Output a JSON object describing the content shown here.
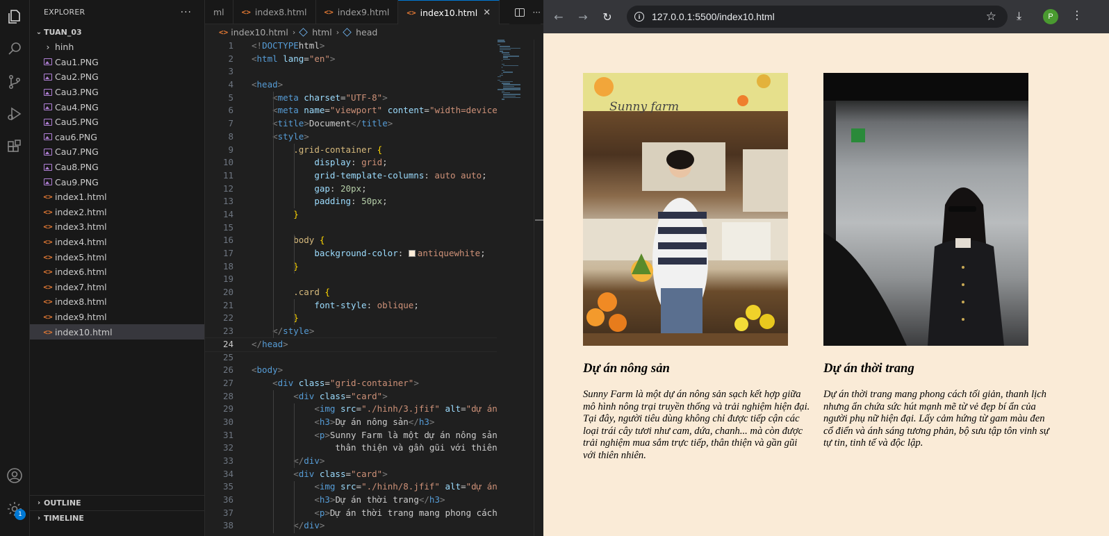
{
  "explorer": {
    "header": "EXPLORER",
    "folder": "TUAN_03",
    "items": [
      {
        "label": "hinh",
        "type": "folder"
      },
      {
        "label": "Cau1.PNG",
        "type": "image"
      },
      {
        "label": "Cau2.PNG",
        "type": "image"
      },
      {
        "label": "Cau3.PNG",
        "type": "image"
      },
      {
        "label": "Cau4.PNG",
        "type": "image"
      },
      {
        "label": "Cau5.PNG",
        "type": "image"
      },
      {
        "label": "cau6.PNG",
        "type": "image"
      },
      {
        "label": "Cau7.PNG",
        "type": "image"
      },
      {
        "label": "Cau8.PNG",
        "type": "image"
      },
      {
        "label": "Cau9.PNG",
        "type": "image"
      },
      {
        "label": "index1.html",
        "type": "html"
      },
      {
        "label": "index2.html",
        "type": "html"
      },
      {
        "label": "index3.html",
        "type": "html"
      },
      {
        "label": "index4.html",
        "type": "html"
      },
      {
        "label": "index5.html",
        "type": "html"
      },
      {
        "label": "index6.html",
        "type": "html"
      },
      {
        "label": "index7.html",
        "type": "html"
      },
      {
        "label": "index8.html",
        "type": "html"
      },
      {
        "label": "index9.html",
        "type": "html"
      },
      {
        "label": "index10.html",
        "type": "html",
        "selected": true
      }
    ],
    "outline": "OUTLINE",
    "timeline": "TIMELINE"
  },
  "activity": {
    "badge": "1"
  },
  "tabs": [
    {
      "label": "ml",
      "active": false
    },
    {
      "label": "index8.html",
      "active": false
    },
    {
      "label": "index9.html",
      "active": false
    },
    {
      "label": "index10.html",
      "active": true
    }
  ],
  "breadcrumb": {
    "file": "index10.html",
    "node1": "html",
    "node2": "head"
  },
  "code": {
    "current_line": 24,
    "lines": [
      [
        [
          "t-pun",
          "<!"
        ],
        [
          "t-tag",
          "DOCTYPE"
        ],
        [
          "",
          "html"
        ],
        [
          "t-pun",
          ">"
        ]
      ],
      [
        [
          "t-pun",
          "<"
        ],
        [
          "t-tag",
          "html"
        ],
        [
          "",
          " "
        ],
        [
          "t-attr",
          "lang"
        ],
        [
          "",
          "="
        ],
        [
          "t-str",
          "\"en\""
        ],
        [
          "t-pun",
          ">"
        ]
      ],
      [],
      [
        [
          "t-pun",
          "<"
        ],
        [
          "t-tag",
          "head"
        ],
        [
          "t-pun",
          ">"
        ]
      ],
      [
        [
          "",
          "    "
        ],
        [
          "t-pun",
          "<"
        ],
        [
          "t-tag",
          "meta"
        ],
        [
          "",
          " "
        ],
        [
          "t-attr",
          "charset"
        ],
        [
          "",
          "="
        ],
        [
          "t-str",
          "\"UTF-8\""
        ],
        [
          "t-pun",
          ">"
        ]
      ],
      [
        [
          "",
          "    "
        ],
        [
          "t-pun",
          "<"
        ],
        [
          "t-tag",
          "meta"
        ],
        [
          "",
          " "
        ],
        [
          "t-attr",
          "name"
        ],
        [
          "",
          "="
        ],
        [
          "t-str",
          "\"viewport\""
        ],
        [
          "",
          " "
        ],
        [
          "t-attr",
          "content"
        ],
        [
          "",
          "="
        ],
        [
          "t-str",
          "\"width=device"
        ]
      ],
      [
        [
          "",
          "    "
        ],
        [
          "t-pun",
          "<"
        ],
        [
          "t-tag",
          "title"
        ],
        [
          "t-pun",
          ">"
        ],
        [
          "",
          "Document"
        ],
        [
          "t-pun",
          "</"
        ],
        [
          "t-tag",
          "title"
        ],
        [
          "t-pun",
          ">"
        ]
      ],
      [
        [
          "",
          "    "
        ],
        [
          "t-pun",
          "<"
        ],
        [
          "t-tag",
          "style"
        ],
        [
          "t-pun",
          ">"
        ]
      ],
      [
        [
          "",
          "        "
        ],
        [
          "t-sel",
          ".grid-container"
        ],
        [
          "",
          " "
        ],
        [
          "t-br",
          "{"
        ]
      ],
      [
        [
          "",
          "            "
        ],
        [
          "t-prop",
          "display"
        ],
        [
          "",
          ": "
        ],
        [
          "t-val",
          "grid"
        ],
        [
          "",
          ";"
        ]
      ],
      [
        [
          "",
          "            "
        ],
        [
          "t-prop",
          "grid-template-columns"
        ],
        [
          "",
          ": "
        ],
        [
          "t-val",
          "auto auto"
        ],
        [
          "",
          ";"
        ]
      ],
      [
        [
          "",
          "            "
        ],
        [
          "t-prop",
          "gap"
        ],
        [
          "",
          ": "
        ],
        [
          "t-num",
          "20px"
        ],
        [
          "",
          ";"
        ]
      ],
      [
        [
          "",
          "            "
        ],
        [
          "t-prop",
          "padding"
        ],
        [
          "",
          ": "
        ],
        [
          "t-num",
          "50px"
        ],
        [
          "",
          ";"
        ]
      ],
      [
        [
          "",
          "        "
        ],
        [
          "t-br",
          "}"
        ]
      ],
      [],
      [
        [
          "",
          "        "
        ],
        [
          "t-sel",
          "body"
        ],
        [
          "",
          " "
        ],
        [
          "t-br",
          "{"
        ]
      ],
      [
        [
          "",
          "            "
        ],
        [
          "t-prop",
          "background-color"
        ],
        [
          "",
          ": "
        ],
        [
          "swatch",
          ""
        ],
        [
          "t-val",
          "antiquewhite"
        ],
        [
          "",
          ";"
        ]
      ],
      [
        [
          "",
          "        "
        ],
        [
          "t-br",
          "}"
        ]
      ],
      [],
      [
        [
          "",
          "        "
        ],
        [
          "t-sel",
          ".card"
        ],
        [
          "",
          " "
        ],
        [
          "t-br",
          "{"
        ]
      ],
      [
        [
          "",
          "            "
        ],
        [
          "t-prop",
          "font-style"
        ],
        [
          "",
          ": "
        ],
        [
          "t-val",
          "oblique"
        ],
        [
          "",
          ";"
        ]
      ],
      [
        [
          "",
          "        "
        ],
        [
          "t-br",
          "}"
        ]
      ],
      [
        [
          "",
          "    "
        ],
        [
          "t-pun",
          "</"
        ],
        [
          "t-tag",
          "style"
        ],
        [
          "t-pun",
          ">"
        ]
      ],
      [
        [
          "t-pun",
          "</"
        ],
        [
          "t-tag",
          "head"
        ],
        [
          "t-pun",
          ">"
        ]
      ],
      [],
      [
        [
          "t-pun",
          "<"
        ],
        [
          "t-tag",
          "body"
        ],
        [
          "t-pun",
          ">"
        ]
      ],
      [
        [
          "",
          "    "
        ],
        [
          "t-pun",
          "<"
        ],
        [
          "t-tag",
          "div"
        ],
        [
          "",
          " "
        ],
        [
          "t-attr",
          "class"
        ],
        [
          "",
          "="
        ],
        [
          "t-str",
          "\"grid-container\""
        ],
        [
          "t-pun",
          ">"
        ]
      ],
      [
        [
          "",
          "        "
        ],
        [
          "t-pun",
          "<"
        ],
        [
          "t-tag",
          "div"
        ],
        [
          "",
          " "
        ],
        [
          "t-attr",
          "class"
        ],
        [
          "",
          "="
        ],
        [
          "t-str",
          "\"card\""
        ],
        [
          "t-pun",
          ">"
        ]
      ],
      [
        [
          "",
          "            "
        ],
        [
          "t-pun",
          "<"
        ],
        [
          "t-tag",
          "img"
        ],
        [
          "",
          " "
        ],
        [
          "t-attr",
          "src"
        ],
        [
          "",
          "="
        ],
        [
          "t-str",
          "\"./hinh/3.jfif\""
        ],
        [
          "",
          " "
        ],
        [
          "t-attr",
          "alt"
        ],
        [
          "",
          "="
        ],
        [
          "t-str",
          "\"dự án"
        ]
      ],
      [
        [
          "",
          "            "
        ],
        [
          "t-pun",
          "<"
        ],
        [
          "t-tag",
          "h3"
        ],
        [
          "t-pun",
          ">"
        ],
        [
          "",
          "Dự án nông sản"
        ],
        [
          "t-pun",
          "</"
        ],
        [
          "t-tag",
          "h3"
        ],
        [
          "t-pun",
          ">"
        ]
      ],
      [
        [
          "",
          "            "
        ],
        [
          "t-pun",
          "<"
        ],
        [
          "t-tag",
          "p"
        ],
        [
          "t-pun",
          ">"
        ],
        [
          "",
          "Sunny Farm là một dự án nông sản"
        ]
      ],
      [
        [
          "",
          "                thân thiện và gần gũi với thiên"
        ]
      ],
      [
        [
          "",
          "        "
        ],
        [
          "t-pun",
          "</"
        ],
        [
          "t-tag",
          "div"
        ],
        [
          "t-pun",
          ">"
        ]
      ],
      [
        [
          "",
          "        "
        ],
        [
          "t-pun",
          "<"
        ],
        [
          "t-tag",
          "div"
        ],
        [
          "",
          " "
        ],
        [
          "t-attr",
          "class"
        ],
        [
          "",
          "="
        ],
        [
          "t-str",
          "\"card\""
        ],
        [
          "t-pun",
          ">"
        ]
      ],
      [
        [
          "",
          "            "
        ],
        [
          "t-pun",
          "<"
        ],
        [
          "t-tag",
          "img"
        ],
        [
          "",
          " "
        ],
        [
          "t-attr",
          "src"
        ],
        [
          "",
          "="
        ],
        [
          "t-str",
          "\"./hinh/8.jfif\""
        ],
        [
          "",
          " "
        ],
        [
          "t-attr",
          "alt"
        ],
        [
          "",
          "="
        ],
        [
          "t-str",
          "\"dự án"
        ]
      ],
      [
        [
          "",
          "            "
        ],
        [
          "t-pun",
          "<"
        ],
        [
          "t-tag",
          "h3"
        ],
        [
          "t-pun",
          ">"
        ],
        [
          "",
          "Dự án thời trang"
        ],
        [
          "t-pun",
          "</"
        ],
        [
          "t-tag",
          "h3"
        ],
        [
          "t-pun",
          ">"
        ]
      ],
      [
        [
          "",
          "            "
        ],
        [
          "t-pun",
          "<"
        ],
        [
          "t-tag",
          "p"
        ],
        [
          "t-pun",
          ">"
        ],
        [
          "",
          "Dự án thời trang mang phong cách"
        ]
      ],
      [
        [
          "",
          "        "
        ],
        [
          "t-pun",
          "</"
        ],
        [
          "t-tag",
          "div"
        ],
        [
          "t-pun",
          ">"
        ]
      ]
    ]
  },
  "browser": {
    "url": "127.0.0.1:5500/index10.html",
    "profile_initial": "P",
    "cards": [
      {
        "title": "Dự án nông sản",
        "text": "Sunny Farm là một dự án nông sản sạch kết hợp giữa mô hình nông trại truyền thống và trải nghiệm hiện đại. Tại đây, người tiêu dùng không chỉ được tiếp cận các loại trái cây tươi như cam, dứa, chanh... mà còn được trải nghiệm mua sắm trực tiếp, thân thiện và gần gũi với thiên nhiên.",
        "photo_sign": "Sunny farm"
      },
      {
        "title": "Dự án thời trang",
        "text": "Dự án thời trang mang phong cách tối giản, thanh lịch nhưng ẩn chứa sức hút mạnh mẽ từ vẻ đẹp bí ẩn của người phụ nữ hiện đại. Lấy cảm hứng từ gam màu đen cổ điển và ánh sáng tương phản, bộ sưu tập tôn vinh sự tự tin, tinh tế và độc lập."
      }
    ]
  }
}
